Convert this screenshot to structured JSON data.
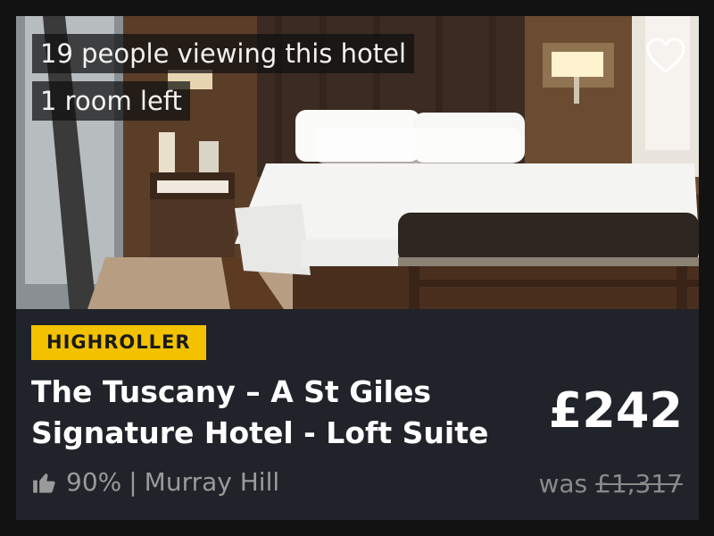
{
  "listing": {
    "viewers_text": "19 people viewing this hotel",
    "rooms_text": "1 room left",
    "tag": "HIGHROLLER",
    "name": "The Tuscany – A St Giles Signature Hotel - Loft Suite",
    "price": "£242",
    "rating": "90%",
    "separator": "|",
    "location": "Murray Hill",
    "was_label": "was",
    "was_price": "£1,317"
  },
  "icons": {
    "favorite": "heart-icon",
    "rating": "thumbs-up-icon"
  },
  "colors": {
    "card_bg": "#202329",
    "tag_bg": "#f2c200",
    "text": "#ffffff",
    "muted": "#9a9a9a"
  }
}
